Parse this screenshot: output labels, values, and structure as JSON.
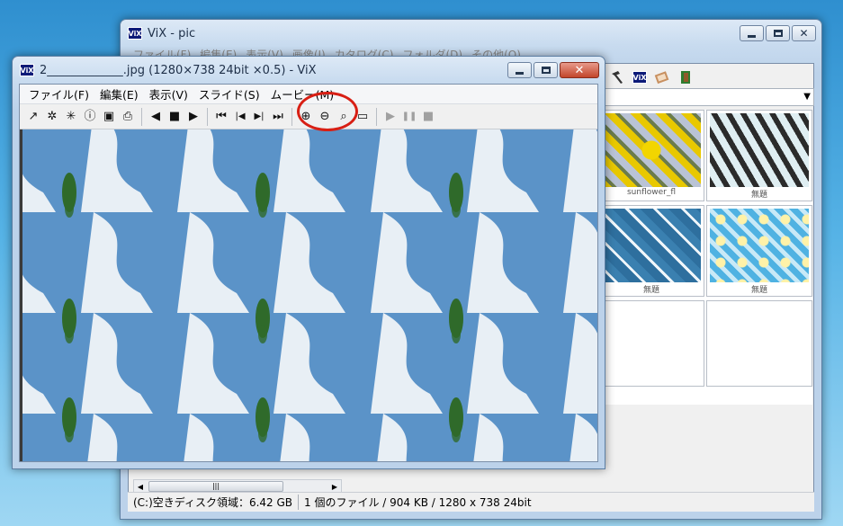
{
  "back_window": {
    "title": "ViX - pic",
    "app_icon_label": "ViX",
    "menu": [
      "ファイル(F)",
      "編集(E)",
      "表示(V)",
      "画像(I)",
      "カタログ(C)",
      "フォルダ(D)",
      "その他(O)"
    ],
    "toolbar_icons": [
      "hammer-icon",
      "vix-icon",
      "book-icon",
      "exit-door-icon"
    ],
    "thumbnail_captions": [
      "sunflower_fl",
      "無題",
      "無題",
      "無題"
    ],
    "scrollbar_grip": "|||",
    "status": {
      "disk": "(C:)空きディスク領域：6.42 GB",
      "files": "1 個のファイル / 904 KB / 1280 x 738 24bit"
    }
  },
  "front_window": {
    "title": "2_____________.jpg (1280×738 24bit ×0.5) - ViX",
    "app_icon_label": "ViX",
    "menu": [
      "ファイル(F)",
      "編集(E)",
      "表示(V)",
      "スライド(S)",
      "ムービー(M)"
    ],
    "toolbar": [
      {
        "icon": "open-icon",
        "glyph": "↗"
      },
      {
        "icon": "sparkle-icon",
        "glyph": "✲"
      },
      {
        "icon": "sparkle-cursor-icon",
        "glyph": "✳"
      },
      {
        "icon": "info-icon",
        "glyph": "ⓘ"
      },
      {
        "icon": "save-icon",
        "glyph": "▣"
      },
      {
        "icon": "print-icon",
        "glyph": "⎙"
      },
      {
        "icon": "prev-icon",
        "glyph": "◀"
      },
      {
        "icon": "stop-icon",
        "glyph": "■"
      },
      {
        "icon": "next-icon",
        "glyph": "▶"
      },
      {
        "icon": "first-icon",
        "glyph": "⏮"
      },
      {
        "icon": "step-back-icon",
        "glyph": "|◀"
      },
      {
        "icon": "step-forward-icon",
        "glyph": "▶|"
      },
      {
        "icon": "last-icon",
        "glyph": "⏭"
      },
      {
        "icon": "zoom-in-icon",
        "glyph": "⊕"
      },
      {
        "icon": "zoom-out-icon",
        "glyph": "⊖"
      },
      {
        "icon": "zoom-fit-icon",
        "glyph": "⌕"
      },
      {
        "icon": "fullscreen-icon",
        "glyph": "▭"
      },
      {
        "icon": "play-icon",
        "glyph": "▶"
      },
      {
        "icon": "pause-icon",
        "glyph": "❚❚"
      },
      {
        "icon": "movie-stop-icon",
        "glyph": "■"
      }
    ]
  },
  "colors": {
    "highlight": "#d81f14",
    "sky": "#5b93c8",
    "cloud": "#f4f6f8",
    "tree": "#2f6a2a"
  }
}
